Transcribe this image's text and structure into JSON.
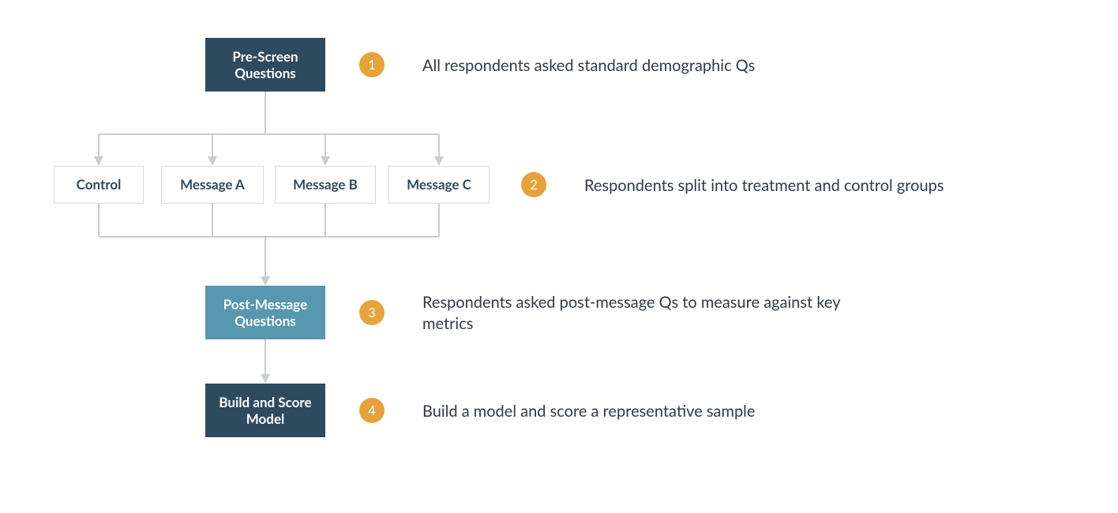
{
  "boxes": {
    "prescreen": "Pre-Screen Questions",
    "control": "Control",
    "msgA": "Message A",
    "msgB": "Message B",
    "msgC": "Message C",
    "postmsg": "Post-Message Questions",
    "model": "Build and Score Model"
  },
  "steps": {
    "s1": {
      "num": "1",
      "text": "All respondents asked standard demographic Qs"
    },
    "s2": {
      "num": "2",
      "text": "Respondents split into treatment and control groups"
    },
    "s3": {
      "num": "3",
      "text": "Respondents asked post-message Qs to measure against key metrics"
    },
    "s4": {
      "num": "4",
      "text": "Build a model and score a representative sample"
    }
  },
  "colors": {
    "dark": "#2e4a5e",
    "light": "#5797b0",
    "badge": "#e7a23b",
    "outline": "#d7dbdf",
    "arrow": "#c9ced3"
  }
}
